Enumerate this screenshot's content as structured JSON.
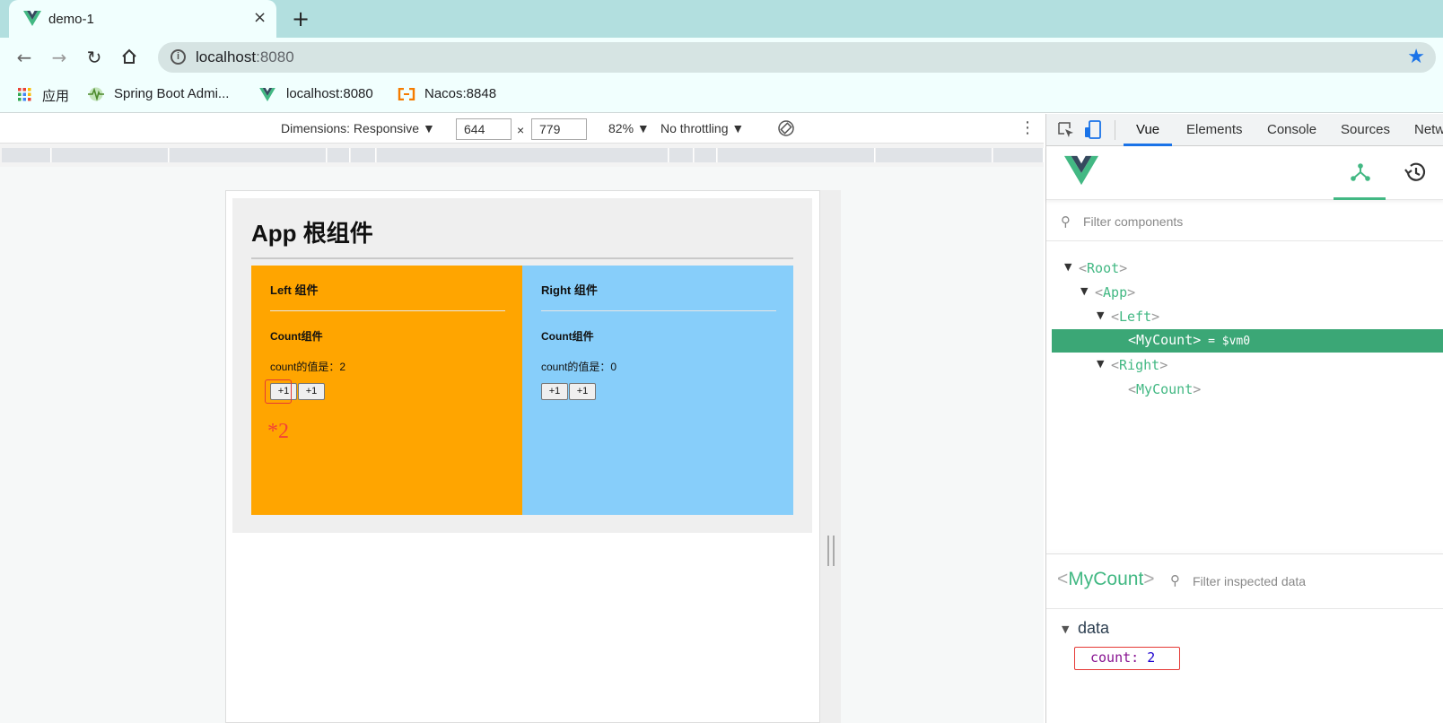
{
  "browser": {
    "tab_title": "demo-1",
    "close_icon": "×",
    "new_tab_icon": "+",
    "url_host": "localhost",
    "url_port": ":8080",
    "bookmarks": [
      {
        "label": "应用",
        "icon": "apps-grid-icon"
      },
      {
        "label": "Spring Boot Admi...",
        "icon": "pulse-icon"
      },
      {
        "label": "localhost:8080",
        "icon": "vue-logo-icon"
      },
      {
        "label": "Nacos:8848",
        "icon": "nacos-icon"
      }
    ]
  },
  "device_toolbar": {
    "dimensions_label": "Dimensions: Responsive ▼",
    "width": "644",
    "times": "×",
    "height": "779",
    "zoom": "82% ▼",
    "throttling": "No throttling ▼"
  },
  "page": {
    "app_title": "App 根组件",
    "left": {
      "title": "Left 组件",
      "count_title": "Count组件",
      "count_text": "count的值是：2",
      "btn1": "+1",
      "btn2": "+1",
      "annotation": "*2"
    },
    "right": {
      "title": "Right 组件",
      "count_title": "Count组件",
      "count_text": "count的值是：0",
      "btn1": "+1",
      "btn2": "+1"
    }
  },
  "devtools": {
    "tabs": [
      "Vue",
      "Elements",
      "Console",
      "Sources",
      "Netw"
    ],
    "active_tab": "Vue",
    "filter_placeholder": "Filter components",
    "tree": [
      {
        "name": "Root",
        "depth": 0,
        "expanded": true
      },
      {
        "name": "App",
        "depth": 1,
        "expanded": true
      },
      {
        "name": "Left",
        "depth": 2,
        "expanded": true
      },
      {
        "name": "MyCount",
        "depth": 3,
        "selected": true,
        "suffix": " = $vm0"
      },
      {
        "name": "Right",
        "depth": 2,
        "expanded": true
      },
      {
        "name": "MyCount",
        "depth": 3
      }
    ],
    "inspect_name": "MyCount",
    "inspect_filter_placeholder": "Filter inspected data",
    "data_section": "data",
    "prop_key": "count",
    "prop_value": "2"
  },
  "colors": {
    "left_panel": "#ffa500",
    "right_panel": "#87cefa",
    "vue_green": "#42b883",
    "selected_row": "#3ba776",
    "annotation_red": "#e53935"
  }
}
